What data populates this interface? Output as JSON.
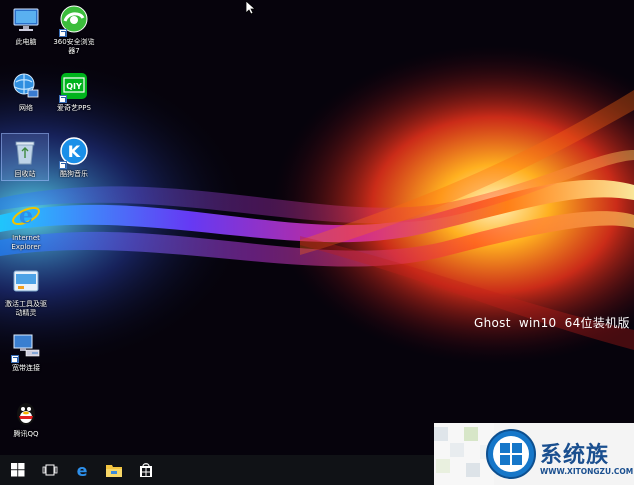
{
  "desktop_icons": [
    {
      "label": "此电脑",
      "icon": "computer-icon"
    },
    {
      "label": "360安全浏览器7",
      "icon": "browser-360-icon"
    },
    {
      "label": "网络",
      "icon": "network-icon"
    },
    {
      "label": "爱奇艺PPS",
      "icon": "iqiyi-icon"
    },
    {
      "label": "回收站",
      "icon": "recycle-bin-icon"
    },
    {
      "label": "酷狗音乐",
      "icon": "kugou-icon"
    },
    {
      "label": "Internet Explorer",
      "icon": "internet-explorer-icon"
    },
    {
      "label": "激活工具及驱动精灵",
      "icon": "activation-tool-icon"
    },
    {
      "label": "宽带连接",
      "icon": "broadband-connection-icon"
    },
    {
      "label": "腾讯QQ",
      "icon": "qq-icon"
    }
  ],
  "wallpaper_text": "Ghost  win10  64位装机版",
  "site_logo": {
    "brand": "系统族",
    "url": "WWW.XITONGZU.COM"
  },
  "taskbar": [
    "start-icon",
    "task-view-icon",
    "edge-icon",
    "file-explorer-icon",
    "store-icon"
  ],
  "colors": {
    "taskbar": "#101216",
    "accent": "#1a4f8f"
  }
}
